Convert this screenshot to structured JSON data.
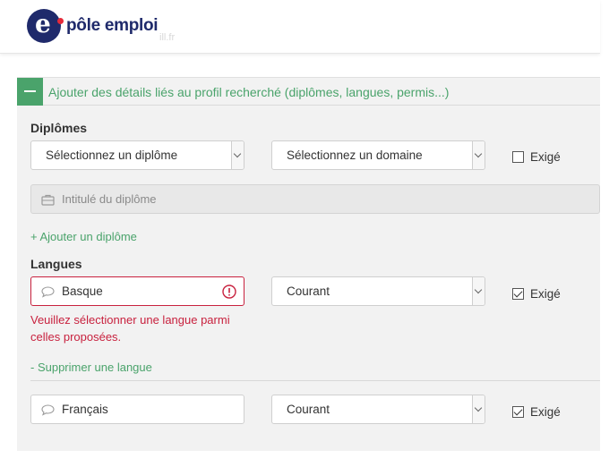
{
  "header": {
    "logo_text": "pôle emploi",
    "ghost_text": "ill.fr"
  },
  "panel": {
    "title": "Ajouter des détails liés au profil recherché (diplômes, langues, permis...)"
  },
  "diplomes": {
    "label": "Diplômes",
    "diploma_select": "Sélectionnez un diplôme",
    "domain_select": "Sélectionnez un domaine",
    "required_label": "Exigé",
    "title_placeholder": "Intitulé du diplôme",
    "add_link": "+ Ajouter un diplôme"
  },
  "langues": {
    "label": "Langues",
    "rows": [
      {
        "language": "Basque",
        "level": "Courant",
        "required_label": "Exigé"
      },
      {
        "language": "Français",
        "level": "Courant",
        "required_label": "Exigé"
      }
    ],
    "error_message": "Veuillez sélectionner une langue parmi celles proposées.",
    "remove_link": "- Supprimer une langue"
  }
}
